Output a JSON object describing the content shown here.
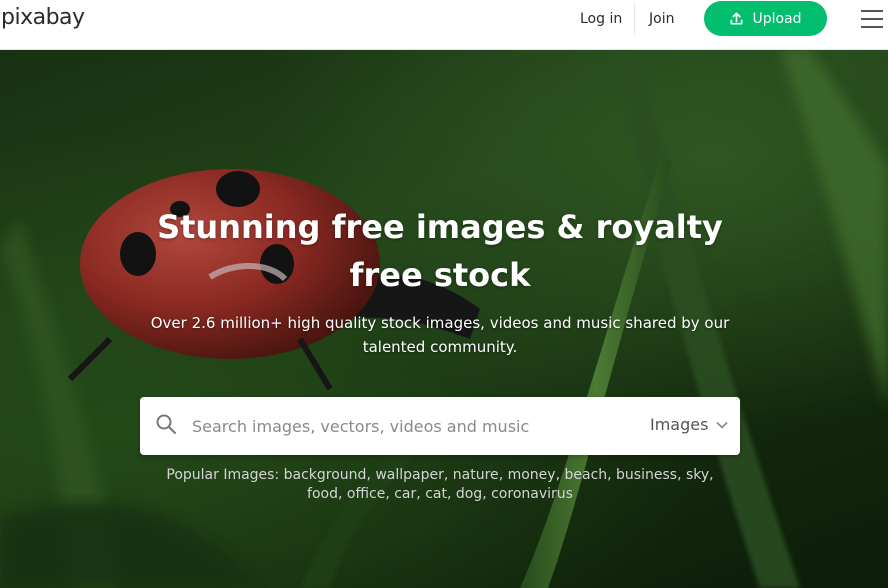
{
  "header": {
    "logo": "pixabay",
    "login_label": "Log in",
    "join_label": "Join",
    "upload_label": "Upload"
  },
  "hero": {
    "title": "Stunning free images & royalty free stock",
    "subtitle": "Over 2.6 million+ high quality stock images, videos and music shared by our talented community."
  },
  "search": {
    "placeholder": "Search images, vectors, videos and music",
    "type_selected": "Images"
  },
  "popular": {
    "prefix": "Popular Images:",
    "tags": [
      "background",
      "wallpaper",
      "nature",
      "money",
      "beach",
      "business",
      "sky",
      "food",
      "office",
      "car",
      "cat",
      "dog",
      "coronavirus"
    ]
  },
  "colors": {
    "accent": "#02be6e",
    "header_text": "#2b2b2b",
    "hero_text": "#ffffff"
  }
}
